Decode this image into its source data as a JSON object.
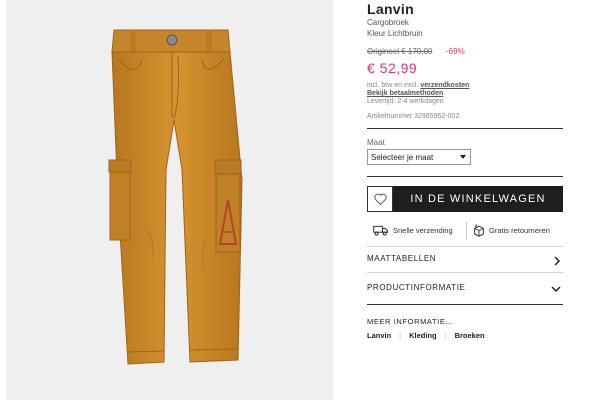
{
  "product": {
    "brand": "Lanvin",
    "subtitle": "Cargobroek",
    "color": "Kleur Lichtbruin",
    "original_price": "Origineel € 170,00",
    "discount": "-69%",
    "price": "€ 52,99",
    "shipping_prefix": "incl. btw en excl.",
    "shipping_link": "verzendkosten",
    "payment_link": "Bekijk betaalmethoden",
    "delivery": "Levertijd: 2-4 werkdagen",
    "article_number": "Artikelnummer 32965962-002",
    "pants_color": "#cc8a2c"
  },
  "size": {
    "label": "Maat",
    "selected": "Selecteer je maat"
  },
  "actions": {
    "cart_label": "IN DE WINKELWAGEN",
    "wishlist_icon": "heart-icon"
  },
  "usps": [
    {
      "icon": "truck-icon",
      "label": "Snelle verzending"
    },
    {
      "icon": "return-box-icon",
      "label": "Gratis retourneren"
    }
  ],
  "accordions": [
    {
      "label": "MAATTABELLEN",
      "icon": "chevron-right-icon"
    },
    {
      "label": "PRODUCTINFORMATIE",
      "icon": "chevron-down-icon"
    }
  ],
  "more": {
    "title": "MEER INFORMATIE...",
    "links": [
      "Lanvin",
      "Kleding",
      "Broeken"
    ]
  }
}
